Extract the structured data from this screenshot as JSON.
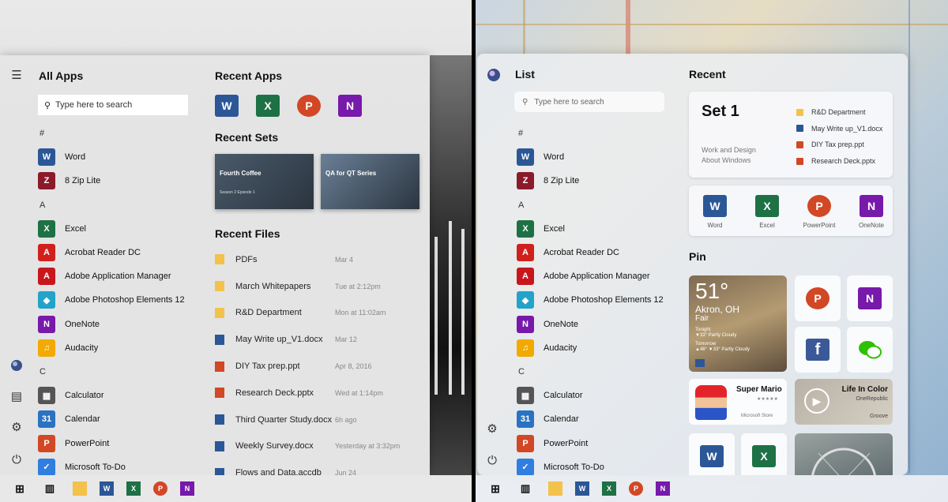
{
  "left": {
    "all_apps_title": "All Apps",
    "search_placeholder": "Type here to search",
    "recent_apps_title": "Recent Apps",
    "recent_sets_title": "Recent Sets",
    "recent_files_title": "Recent Files",
    "apps": [
      {
        "kind": "letter",
        "label": "#"
      },
      {
        "kind": "app",
        "label": "Word",
        "icon": "word-icon",
        "color": "#2b5797",
        "glyph": "W"
      },
      {
        "kind": "app",
        "label": "8 Zip Lite",
        "icon": "8zip-icon",
        "color": "#8b1a2b",
        "glyph": "Z"
      },
      {
        "kind": "letter",
        "label": "A"
      },
      {
        "kind": "app",
        "label": "Excel",
        "icon": "excel-icon",
        "color": "#1e7145",
        "glyph": "X"
      },
      {
        "kind": "app",
        "label": "Acrobat Reader DC",
        "icon": "acrobat-icon",
        "color": "#d0201d",
        "glyph": "A"
      },
      {
        "kind": "app",
        "label": "Adobe Application Manager",
        "icon": "adobe-icon",
        "color": "#c8161d",
        "glyph": "A"
      },
      {
        "kind": "app",
        "label": "Adobe Photoshop Elements 12",
        "icon": "photoshop-icon",
        "color": "#23a3c9",
        "glyph": "◆"
      },
      {
        "kind": "app",
        "label": "OneNote",
        "icon": "onenote-icon",
        "color": "#7719aa",
        "glyph": "N"
      },
      {
        "kind": "app",
        "label": "Audacity",
        "icon": "audacity-icon",
        "color": "#f2a900",
        "glyph": "♫"
      },
      {
        "kind": "letter",
        "label": "C"
      },
      {
        "kind": "app",
        "label": "Calculator",
        "icon": "calculator-icon",
        "color": "#555555",
        "glyph": "▦"
      },
      {
        "kind": "app",
        "label": "Calendar",
        "icon": "calendar-icon",
        "color": "#2a72c2",
        "glyph": "31"
      },
      {
        "kind": "app",
        "label": "PowerPoint",
        "icon": "powerpoint-icon",
        "color": "#d24726",
        "glyph": "P"
      },
      {
        "kind": "app",
        "label": "Microsoft To-Do",
        "icon": "todo-icon",
        "color": "#2f7ee0",
        "glyph": "✓"
      }
    ],
    "sets": [
      {
        "title": "Fourth Coffee",
        "subtitle": "Season 2 Episode 1",
        "bg": "#4a5a6a"
      },
      {
        "title": "QA for QT Series",
        "subtitle": "",
        "bg": "#6a7f96"
      }
    ],
    "files": [
      {
        "name": "PDFs",
        "date": "Mar 4",
        "type": "folder"
      },
      {
        "name": "March Whitepapers",
        "date": "Tue at 2:12pm",
        "type": "folder"
      },
      {
        "name": "R&D Department",
        "date": "Mon at 11:02am",
        "type": "folder"
      },
      {
        "name": "May Write up_V1.docx",
        "date": "Mar 12",
        "type": "word"
      },
      {
        "name": "DIY Tax prep.ppt",
        "date": "Apr 8, 2016",
        "type": "ppt"
      },
      {
        "name": "Research Deck.pptx",
        "date": "Wed at 1:14pm",
        "type": "ppt"
      },
      {
        "name": "Third Quarter Study.docx",
        "date": "6h ago",
        "type": "word"
      },
      {
        "name": "Weekly Survey.docx",
        "date": "Yesterday at 3:32pm",
        "type": "word"
      },
      {
        "name": "Flows and Data.accdb",
        "date": "Jun 24",
        "type": "word"
      }
    ]
  },
  "right": {
    "list_title": "List",
    "recent_title": "Recent",
    "pin_title": "Pin",
    "search_placeholder": "Type here to search",
    "set_title": "Set 1",
    "set_sub_1": "Work and Design",
    "set_sub_2": "About Windows",
    "set_files": [
      {
        "name": "R&D Department",
        "color": "#f3c24a"
      },
      {
        "name": "May Write up_V1.docx",
        "color": "#2b5797"
      },
      {
        "name": "DIY Tax prep.ppt",
        "color": "#d24726"
      },
      {
        "name": "Research Deck.pptx",
        "color": "#d24726"
      }
    ],
    "office_apps": [
      {
        "label": "Word",
        "color": "#2b5797",
        "glyph": "W"
      },
      {
        "label": "Excel",
        "color": "#1e7145",
        "glyph": "X"
      },
      {
        "label": "PowerPoint",
        "color": "#d24726",
        "glyph": "P"
      },
      {
        "label": "OneNote",
        "color": "#7719aa",
        "glyph": "N"
      }
    ],
    "weather": {
      "temp": "51°",
      "city": "Akron, OH",
      "cond": "Fair",
      "tonight_label": "Tonight",
      "tonight": "▼33° Partly Cloudy",
      "tomorrow_label": "Tomorrow",
      "tomorrow": "▲48° ▼33° Partly Cloudy"
    },
    "mario": {
      "title": "Super Mario",
      "stars": "★★★★★",
      "store": "Microsoft Store"
    },
    "music": {
      "title": "Life In Color",
      "artist": "OneRepublic",
      "app": "Groove"
    }
  }
}
